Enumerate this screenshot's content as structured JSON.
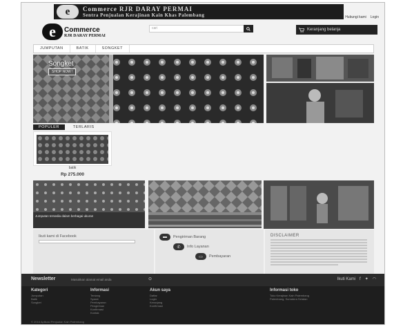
{
  "banner": {
    "logo_letter": "e",
    "title": "Commerce  RJR DARAY PERMAI",
    "subtitle": "Sentra Penjualan Kerajinan Kain Khas Palembang"
  },
  "userlinks": {
    "register": "Hubungi kami",
    "login": "Login"
  },
  "logo": {
    "letter": "e",
    "name": "Commerce",
    "tag": "RJR DARAY PERMAI"
  },
  "search": {
    "placeholder": "cari",
    "icon": "search-icon"
  },
  "cart": {
    "label": "Keranjang belanja",
    "icon": "cart-icon"
  },
  "nav": {
    "items": [
      {
        "label": "JUMPUTAN"
      },
      {
        "label": "BATIK"
      },
      {
        "label": "SONGKET"
      }
    ]
  },
  "hero": {
    "title": "Songket",
    "button": "SHOP NOW !"
  },
  "tabs": [
    {
      "label": "POPULER"
    },
    {
      "label": "TERLARIS"
    }
  ],
  "product": {
    "name": "batik",
    "price": "Rp 275.000"
  },
  "caption": "Jumputan  tersedia dalam berbagai ukuran",
  "facebook": {
    "title": "Ikuti kami di Facebook"
  },
  "services": [
    {
      "label": "Pengiriman Barang"
    },
    {
      "label": "Info Layanan"
    },
    {
      "label": "Pembayaran"
    }
  ],
  "disclaimer": {
    "title": "DISCLAIMER"
  },
  "newsletter": {
    "title": "Newsletter",
    "placeholder": "Masukkan alamat email anda",
    "follow": "Ikuti Kami"
  },
  "footer": {
    "columns": [
      {
        "title": "Kategori",
        "items": [
          "Jumputan",
          "Batik",
          "Songket"
        ]
      },
      {
        "title": "Informasi",
        "items": [
          "Tentang",
          "Syarat",
          "Pembayaran",
          "Pengiriman",
          "Konfirmasi",
          "Kontak"
        ]
      },
      {
        "title": "Akun saya",
        "items": [
          "Daftar",
          "Login",
          "Keranjang",
          "Konfirmasi"
        ]
      },
      {
        "title": "Informasi toko",
        "items": [
          "Toko Kerajinan Kain Palembang",
          "Palembang, Sumatera Selatan"
        ]
      }
    ],
    "copyright": "© 2016 Aplikasi Penjualan Kain Palembang"
  }
}
